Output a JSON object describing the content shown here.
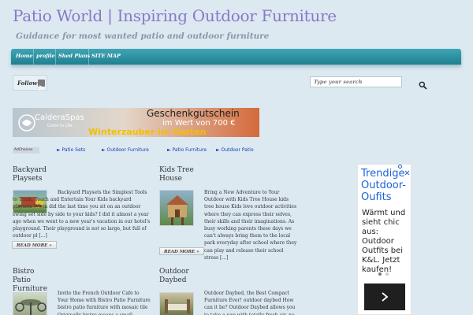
{
  "site": {
    "title": "Patio World | Inspiring Outdoor Furniture",
    "tagline": "Guidance for most wanted patio and outdoor furniture"
  },
  "nav": {
    "items": [
      "Home",
      "profile",
      "Shed Plans",
      "SITE MAP"
    ]
  },
  "follow": {
    "label": "Follow",
    "icon": "rss-icon"
  },
  "search": {
    "placeholder": "Type your search",
    "icon": "search-icon"
  },
  "banner": {
    "brand": "CalderaSpas",
    "brand_sub": "Come to Life",
    "headline": "Geschenkgutschein",
    "subline": "im Wert von 700 €",
    "tagline": "Winterzauber im Garten"
  },
  "ad_links": {
    "adchoices": "AdChoices",
    "links": [
      "► Patio Sets",
      "► Outdoor Furniture",
      "► Patio Furniture",
      "► Outdoor Patio"
    ]
  },
  "posts": [
    {
      "title": "Backyard Playsets",
      "excerpt": "Backyard Playsets the Simplest Tools to Train, Teach and Entertain Your Kids backyard playsets When did the last time you sit on an outdoor swing set side by side to your kids? I did it almost a year ago when we went to a new year's vacation in our hotel's playground. Their playground is not so large, but full of outdoor pl [...]",
      "read_more": "READ MORE »"
    },
    {
      "title": "Kids Tree House",
      "excerpt": "Bring a New Adventure to Your Outdoor with Kids Tree House   kids tree house Kids love outdoor activities where they can express their selves, their skills and their imaginations. As busy working parents these days we can't always bring them to the local park everyday after school where they can play and release their school stress [...]",
      "read_more": "READ MORE »"
    },
    {
      "title": "Bistro Patio Furniture",
      "excerpt": "Invite the French Outdoor Cafe to Your Home with Bistro Patio Furniture   bistro patio furniture with mosaic tile Originally bistro means a small restaurant with",
      "read_more": ""
    },
    {
      "title": "Outdoor Daybed",
      "excerpt": "Outdoor Daybed, the Best Compact Furniture Ever! outdoor daybed How can it be? Outdoor Daybed allows you to take a nap with totally fresh air, no air",
      "read_more": ""
    }
  ],
  "side_ad": {
    "headline": "Trendige Outdoor-Oufits",
    "body": "Wärmt und sieht chic aus: Outdoor Outfits bei K&L. Jetzt kaufen!",
    "next_icon": "chevron-right-icon",
    "accent": "#1c62d9"
  },
  "colors": {
    "background": "#dce9f1",
    "nav": "#2a91a2",
    "title": "#8a78c8",
    "link": "#1a3fb0"
  }
}
